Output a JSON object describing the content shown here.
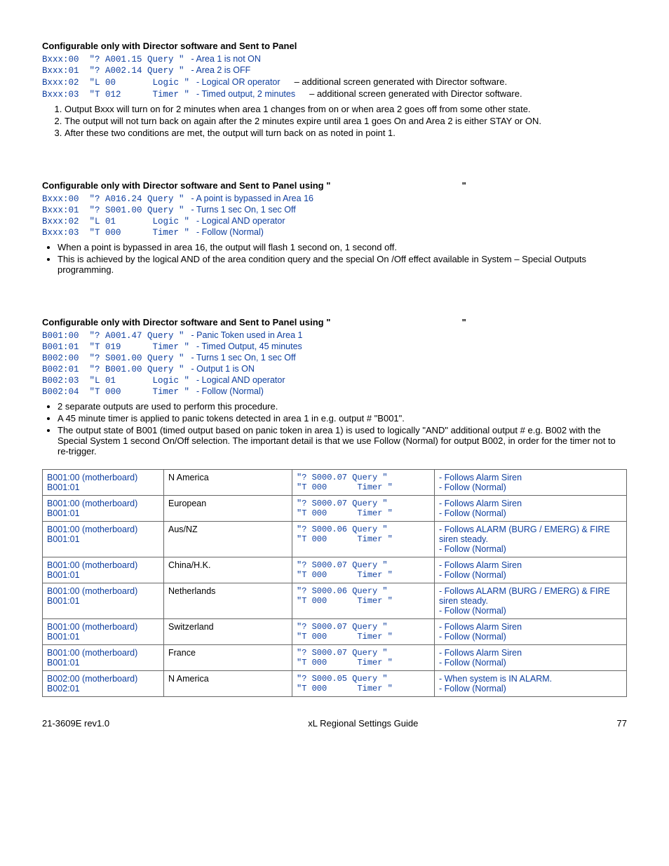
{
  "ex1": {
    "heading": "Configurable only with Director software and Sent to Panel",
    "rows": [
      {
        "code": "Bxxx:00  \"? A001.15 Query \"",
        "desc": "- Area 1 is not ON",
        "extra": ""
      },
      {
        "code": "Bxxx:01  \"? A002.14 Query \"",
        "desc": "- Area 2 is OFF",
        "extra": ""
      },
      {
        "code": "Bxxx:02  \"L 00       Logic \"",
        "desc": "- Logical OR operator",
        "extra": "–  additional screen generated with Director software."
      },
      {
        "code": "Bxxx:03  \"T 012      Timer \"",
        "desc": "- Timed output, 2 minutes",
        "extra": "–  additional screen generated with Director software."
      }
    ],
    "notes": [
      "Output Bxxx will turn on for 2 minutes when area 1 changes from on or when area 2 goes off from some other state.",
      "The output will not turn back on again after the 2 minutes expire until area 1 goes On and Area 2 is either STAY or ON.",
      "After these two conditions are met, the output will turn back on as noted in point 1."
    ]
  },
  "ex2": {
    "heading_pre": "Configurable only with Director software and Sent to Panel using \"",
    "heading_post": "\"",
    "rows": [
      {
        "code": "Bxxx:00  \"? A016.24 Query \"",
        "desc": "- A point is bypassed in Area 16"
      },
      {
        "code": "Bxxx:01  \"? S001.00 Query \"",
        "desc": "- Turns 1 sec On, 1 sec Off"
      },
      {
        "code": "Bxxx:02  \"L 01       Logic \"",
        "desc": "- Logical AND operator"
      },
      {
        "code": "Bxxx:03  \"T 000      Timer \"",
        "desc": "- Follow (Normal)"
      }
    ],
    "bullets": [
      "When a point is bypassed in area 16, the output will flash 1 second on, 1 second off.",
      "This is achieved by the logical AND of the area condition query and the special On /Off effect available in System – Special Outputs programming."
    ]
  },
  "ex3": {
    "heading_pre": "Configurable only with Director software and Sent to Panel using \"",
    "heading_post": "\"",
    "rows": [
      {
        "code": "B001:00  \"? A001.47 Query \"",
        "desc": "- Panic Token used in Area 1"
      },
      {
        "code": "B001:01  \"T 019      Timer \"",
        "desc": "- Timed Output, 45 minutes"
      },
      {
        "code": "B002:00  \"? S001.00 Query \"",
        "desc": "- Turns 1 sec On, 1 sec Off"
      },
      {
        "code": "B002:01  \"? B001.00 Query \"",
        "desc": "- Output 1 is ON"
      },
      {
        "code": "B002:03  \"L 01       Logic \"",
        "desc": "- Logical AND operator"
      },
      {
        "code": "B002:04  \"T 000      Timer \"",
        "desc": "- Follow (Normal)"
      }
    ],
    "bullets": [
      "2 separate outputs are used to perform this procedure.",
      "A 45 minute timer is applied to panic tokens detected in area 1 in e.g. output # \"B001\".",
      "The output state of B001 (timed output based on panic token in area 1) is used to logically \"AND\" additional output # e.g. B002 with the Special System 1 second On/Off selection. The important detail is that we use Follow (Normal) for output B002, in order for the timer not to re-trigger."
    ]
  },
  "table": {
    "rows": [
      {
        "c0a": "B001:00 (motherboard)",
        "c0b": "B001:01",
        "c1": "N America",
        "c2a": "\"? S000.07 Query \"",
        "c2b": "\"T 000      Timer \"",
        "c3a": "- Follows Alarm Siren",
        "c3b": "",
        "c3c": "- Follow (Normal)"
      },
      {
        "c0a": "B001:00 (motherboard)",
        "c0b": "B001:01",
        "c1": "European",
        "c2a": "\"? S000.07 Query \"",
        "c2b": "\"T 000      Timer \"",
        "c3a": "- Follows Alarm Siren",
        "c3b": "",
        "c3c": "- Follow (Normal)"
      },
      {
        "c0a": "B001:00 (motherboard)",
        "c0b": "B001:01",
        "c1": "Aus/NZ",
        "c2a": "\"? S000.06 Query \"",
        "c2b": "\"T 000      Timer \"",
        "c3a": "- Follows ALARM (BURG / EMERG) & FIRE",
        "c3b": "siren steady.",
        "c3c": "- Follow (Normal)"
      },
      {
        "c0a": "B001:00 (motherboard)",
        "c0b": "B001:01",
        "c1": "China/H.K.",
        "c2a": "\"? S000.07 Query \"",
        "c2b": "\"T 000      Timer \"",
        "c3a": "- Follows Alarm Siren",
        "c3b": "",
        "c3c": "- Follow (Normal)"
      },
      {
        "c0a": "B001:00 (motherboard)",
        "c0b": "B001:01",
        "c1": "Netherlands",
        "c2a": "\"? S000.06 Query \"",
        "c2b": "\"T 000      Timer \"",
        "c3a": "- Follows ALARM (BURG / EMERG) & FIRE",
        "c3b": "siren steady.",
        "c3c": "- Follow (Normal)"
      },
      {
        "c0a": "B001:00 (motherboard)",
        "c0b": "B001:01",
        "c1": "Switzerland",
        "c2a": "\"? S000.07 Query \"",
        "c2b": "\"T 000      Timer \"",
        "c3a": "- Follows Alarm Siren",
        "c3b": "",
        "c3c": "- Follow (Normal)"
      },
      {
        "c0a": "B001:00 (motherboard)",
        "c0b": "B001:01",
        "c1": "France",
        "c2a": "\"? S000.07 Query \"",
        "c2b": "\"T 000      Timer \"",
        "c3a": "- Follows Alarm Siren",
        "c3b": "",
        "c3c": "- Follow (Normal)"
      },
      {
        "c0a": "B002:00 (motherboard)",
        "c0b": "B002:01",
        "c1": "N America",
        "c2a": "\"? S000.05 Query \"",
        "c2b": "\"T 000      Timer \"",
        "c3a": "- When system is IN ALARM.",
        "c3b": "",
        "c3c": "- Follow (Normal)"
      }
    ]
  },
  "footer": {
    "left": "21-3609E rev1.0",
    "center": "xL Regional Settings Guide",
    "right": "77"
  }
}
